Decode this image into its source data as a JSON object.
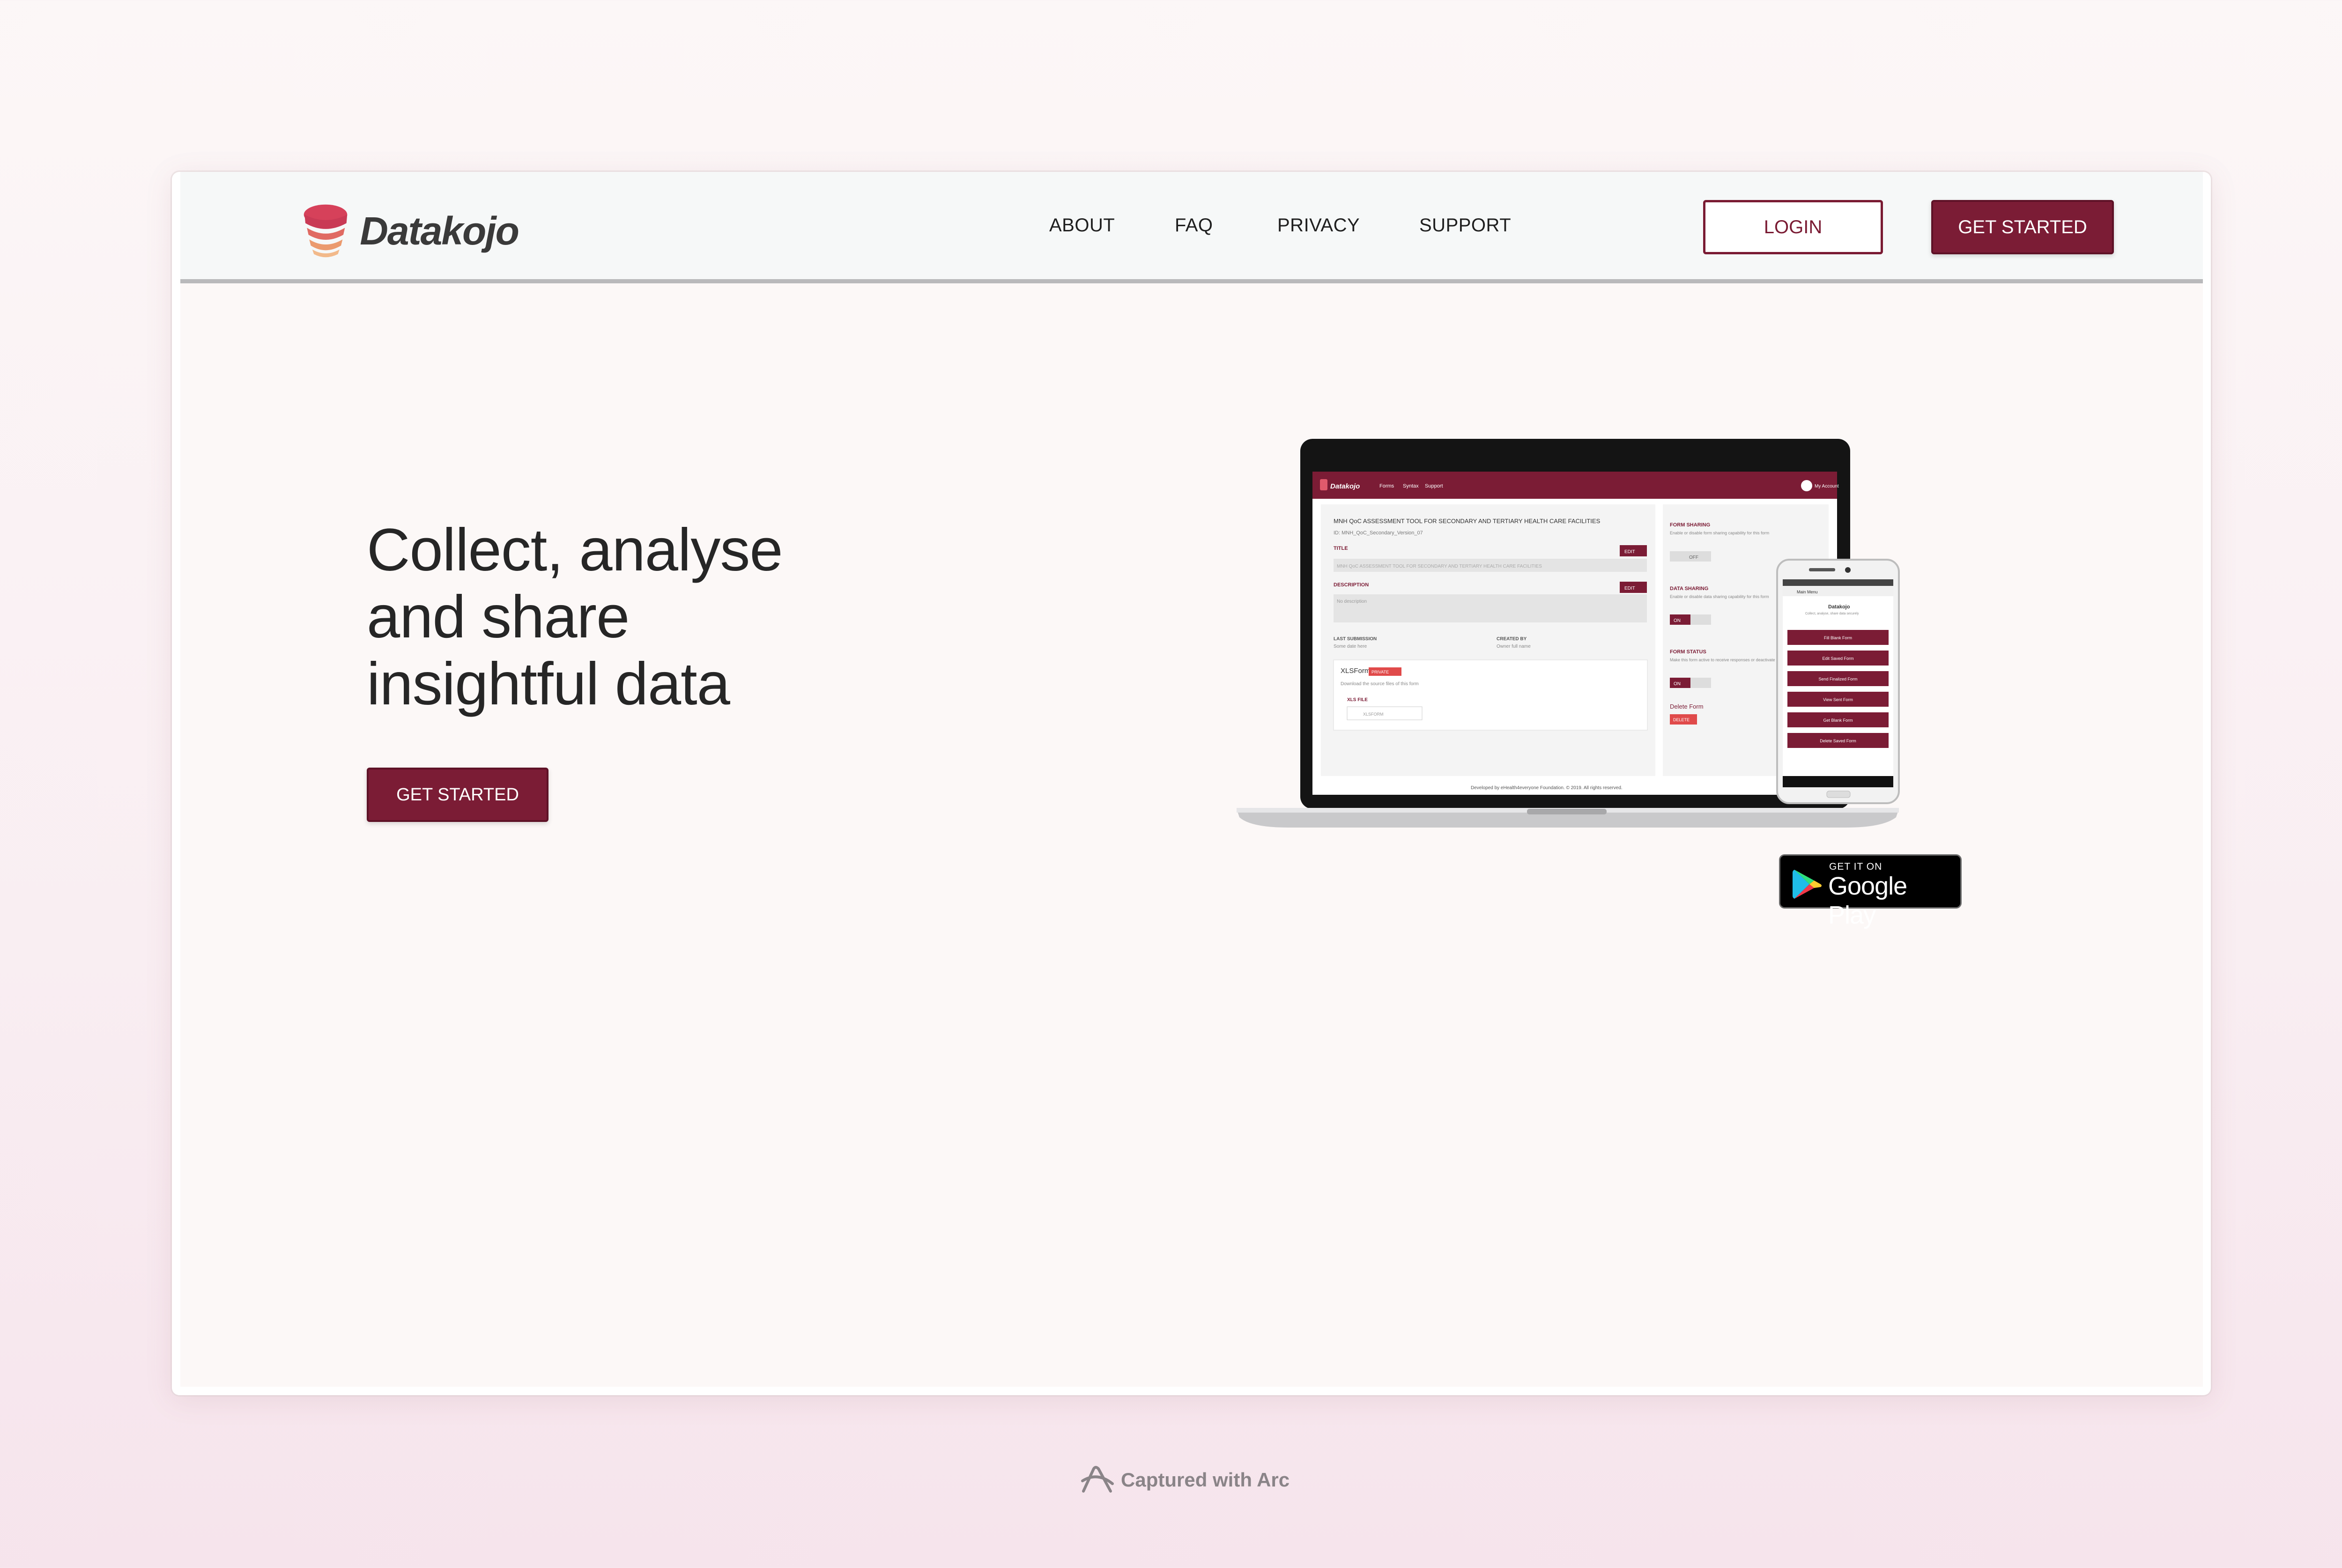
{
  "brand": {
    "name": "Datakojo"
  },
  "nav": {
    "links": [
      "ABOUT",
      "FAQ",
      "PRIVACY",
      "SUPPORT"
    ],
    "login_label": "LOGIN",
    "get_started_label": "GET STARTED"
  },
  "hero": {
    "title_lines": [
      "Collect, analyse",
      "and share",
      "insightful data"
    ],
    "cta_label": "GET STARTED"
  },
  "mockup": {
    "laptop": {
      "brand": "Datakojo",
      "menu": [
        "Forms",
        "Syntax",
        "Support"
      ],
      "account": "My Account",
      "form_title": "MNH QoC ASSESSMENT TOOL FOR SECONDARY AND TERTIARY HEALTH CARE FACILITIES",
      "form_id": "ID: MNH_QoC_Secondary_Version_07",
      "title_label": "TITLE",
      "title_value": "MNH QoC ASSESSMENT TOOL FOR SECONDARY AND TERTIARY HEALTH CARE FACILITIES",
      "edit_label": "EDIT",
      "description_label": "DESCRIPTION",
      "description_value": "No description",
      "last_submission_label": "LAST SUBMISSION",
      "last_submission_value": "Some date here",
      "created_by_label": "CREATED BY",
      "created_by_value": "Owner full name",
      "xlsform_label": "XLSForm",
      "private_label": "PRIVATE",
      "xlsform_note": "Download the source files of this form",
      "xls_file_label": "XLS FILE",
      "xls_button": "XLSFORM",
      "form_sharing_label": "FORM SHARING",
      "form_sharing_note": "Enable or disable form sharing capability for this form",
      "off_label": "OFF",
      "data_sharing_label": "DATA SHARING",
      "data_sharing_note": "Enable or disable data sharing capability for this form",
      "on_label": "ON",
      "form_status_label": "FORM STATUS",
      "form_status_note": "Make this form active to receive responses or deactivate",
      "delete_form_label": "Delete Form",
      "delete_button": "DELETE",
      "footer": "Developed by eHealth4everyone Foundation. © 2019. All rights reserved."
    },
    "phone": {
      "header": "Main Menu",
      "title": "Datakojo",
      "subtitle": "Collect, analyse, share data securely",
      "items": [
        "Fill Blank Form",
        "Edit Saved Form",
        "Send Finalized Form",
        "View Sent Form",
        "Get Blank Form",
        "Delete Saved Form"
      ]
    }
  },
  "badge": {
    "small": "GET IT ON",
    "big": "Google Play"
  },
  "capture": {
    "label": "Captured with Arc"
  },
  "colors": {
    "brand": "#7b1c35",
    "accent": "#d14156"
  },
  "icons": [
    "datakojo-logo-icon",
    "google-play-icon",
    "arc-icon"
  ]
}
